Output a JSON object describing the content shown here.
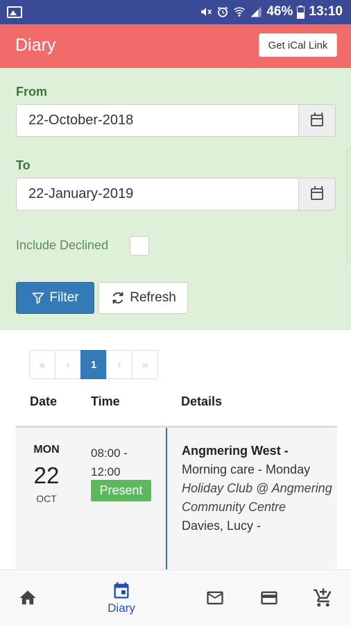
{
  "status_bar": {
    "battery": "46%",
    "time": "13:10"
  },
  "header": {
    "title": "Diary",
    "ical_button": "Get iCal Link"
  },
  "filter": {
    "from_label": "From",
    "from_value": "22-October-2018",
    "to_label": "To",
    "to_value": "22-January-2019",
    "include_declined_label": "Include Declined",
    "include_declined_checked": false,
    "filter_button": "Filter",
    "refresh_button": "Refresh"
  },
  "pagination": {
    "first": "«",
    "prev": "‹",
    "current": "1",
    "next": "›",
    "last": "»"
  },
  "table": {
    "headers": {
      "date": "Date",
      "time": "Time",
      "details": "Details"
    },
    "rows": [
      {
        "day": "MON",
        "date": "22",
        "month": "OCT",
        "time_line1": "08:00 -",
        "time_line2": "12:00",
        "status": "Present",
        "title": "Angmering West -",
        "session": "Morning care - Monday",
        "venue": "Holiday Club @ Angmering Community Centre",
        "person": "Davies, Lucy -"
      }
    ]
  },
  "bottom_nav": {
    "items": [
      {
        "icon": "home-icon"
      },
      {
        "icon": "calendar-icon",
        "label": "Diary",
        "active": true
      },
      {
        "icon": "mail-icon"
      },
      {
        "icon": "credit-card-icon"
      },
      {
        "icon": "add-to-cart-icon"
      }
    ]
  },
  "colors": {
    "status_bar": "#3b4a97",
    "header": "#f26b6b",
    "filter_panel": "#dff0d8",
    "primary": "#337ab7",
    "success": "#5cb85c",
    "nav_active": "#1f4fb4"
  }
}
